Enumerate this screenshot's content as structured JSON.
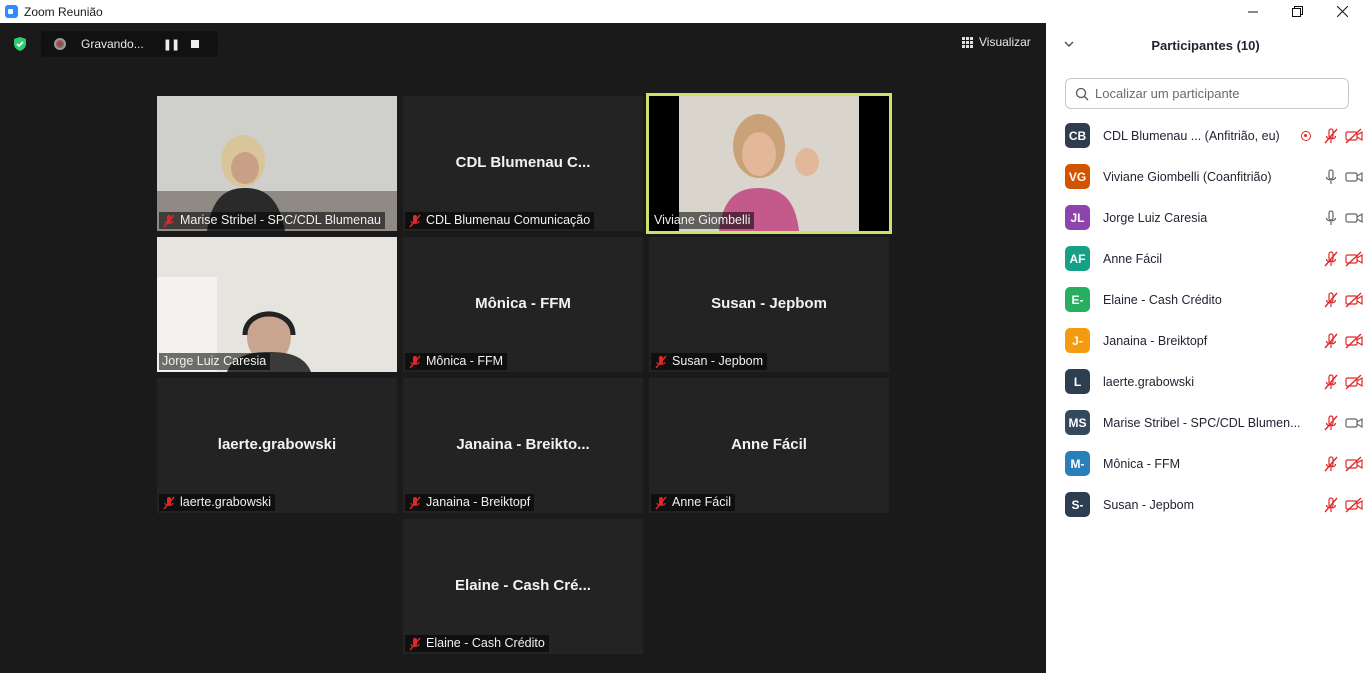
{
  "window": {
    "title": "Zoom Reunião",
    "controls": [
      "minimize",
      "maximize",
      "close"
    ]
  },
  "recording": {
    "status_text": "Gravando...",
    "pause_icon": "pause-icon",
    "stop_icon": "stop-icon"
  },
  "view": {
    "label": "Visualizar"
  },
  "tiles": [
    {
      "center_name": "",
      "label": "Marise Stribel - SPC/CDL Blumenau",
      "muted": true,
      "has_video": true
    },
    {
      "center_name": "CDL Blumenau C...",
      "label": "CDL Blumenau Comunicação",
      "muted": true,
      "has_video": false
    },
    {
      "center_name": "",
      "label": "Viviane Giombelli",
      "muted": false,
      "has_video": true,
      "active_speaker": true
    },
    {
      "center_name": "",
      "label": "Jorge Luiz Caresia",
      "muted": false,
      "has_video": true
    },
    {
      "center_name": "Mônica - FFM",
      "label": "Mônica - FFM",
      "muted": true,
      "has_video": false
    },
    {
      "center_name": "Susan - Jepbom",
      "label": "Susan - Jepbom",
      "muted": true,
      "has_video": false
    },
    {
      "center_name": "laerte.grabowski",
      "label": "laerte.grabowski",
      "muted": true,
      "has_video": false
    },
    {
      "center_name": "Janaina - Breikto...",
      "label": "Janaina - Breiktopf",
      "muted": true,
      "has_video": false
    },
    {
      "center_name": "Anne Fácil",
      "label": "Anne Fácil",
      "muted": true,
      "has_video": false
    },
    {
      "center_name": "Elaine - Cash Cré...",
      "label": "Elaine - Cash Crédito",
      "muted": true,
      "has_video": false
    }
  ],
  "panel": {
    "title": "Participantes (10)",
    "search_placeholder": "Localizar um participante",
    "participants": [
      {
        "initials": "CB",
        "name": "CDL Blumenau ... (Anfitrião, eu)",
        "color": "#2f3d4f",
        "recording": true,
        "mic": "muted",
        "video": "off"
      },
      {
        "initials": "VG",
        "name": "Viviane Giombelli (Coanfitrião)",
        "color": "#d35400",
        "recording": false,
        "mic": "on",
        "video": "on"
      },
      {
        "initials": "JL",
        "name": "Jorge Luiz Caresia",
        "color": "#8e44ad",
        "recording": false,
        "mic": "on",
        "video": "on"
      },
      {
        "initials": "AF",
        "name": "Anne Fácil",
        "color": "#16a085",
        "recording": false,
        "mic": "muted",
        "video": "off"
      },
      {
        "initials": "E-",
        "name": "Elaine - Cash Crédito",
        "color": "#27ae60",
        "recording": false,
        "mic": "muted",
        "video": "off"
      },
      {
        "initials": "J-",
        "name": "Janaina - Breiktopf",
        "color": "#f39c12",
        "recording": false,
        "mic": "muted",
        "video": "off"
      },
      {
        "initials": "L",
        "name": "laerte.grabowski",
        "color": "#2c3e50",
        "recording": false,
        "mic": "muted",
        "video": "off"
      },
      {
        "initials": "MS",
        "name": "Marise Stribel - SPC/CDL Blumen...",
        "color": "#34495e",
        "recording": false,
        "mic": "muted",
        "video": "on"
      },
      {
        "initials": "M-",
        "name": "Mônica - FFM",
        "color": "#2980b9",
        "recording": false,
        "mic": "muted",
        "video": "off"
      },
      {
        "initials": "S-",
        "name": "Susan - Jepbom",
        "color": "#2c3e50",
        "recording": false,
        "mic": "muted",
        "video": "off"
      }
    ]
  }
}
